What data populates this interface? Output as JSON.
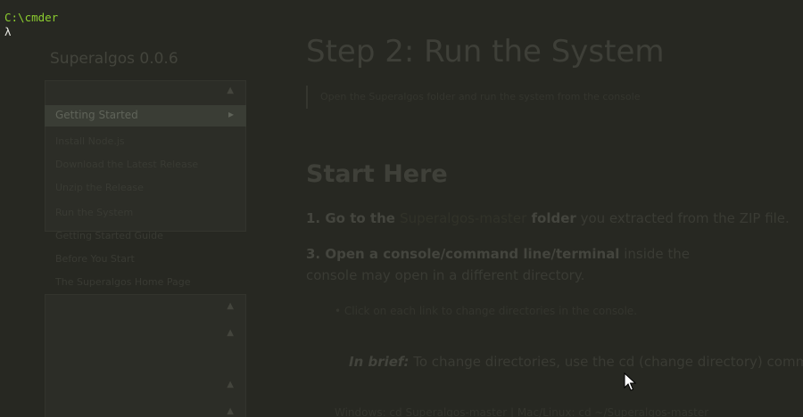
{
  "console": {
    "path": "C:\\cmder",
    "prompt_symbol": "λ"
  },
  "docs": {
    "sidebar": {
      "title": "Superalgos 0.0.6",
      "active_item": "Getting Started",
      "items": [
        "Install Node.js",
        "Download the Latest Release",
        "Unzip the Release"
      ],
      "items_lower": [
        "Run the System",
        "Getting Started Guide",
        "Before You Start",
        "The Superalgos Home Page"
      ]
    },
    "page_title": "Step 2: Run the System",
    "breadcrumb": "Open the Superalgos folder and run the system from the console",
    "section_heading": "Start Here",
    "step1": {
      "prefix": "1. Go to the ",
      "link": "Superalgos-master",
      "bold_suffix": " folder",
      "rest": " you extracted from the ZIP file."
    },
    "step3": {
      "bold": "3. Open a console/command line/terminal",
      "rest": " inside the",
      "line2": "console may open in a different directory."
    },
    "bullet": "Click on each link to change directories in the console.",
    "brief": {
      "label": "In brief:",
      "text": " To change directories, use the cd (change directory) command."
    },
    "bottom_line": "Windows: cd Superalgos-master  |  Mac/Linux: cd ~/Superalgos-master"
  }
}
